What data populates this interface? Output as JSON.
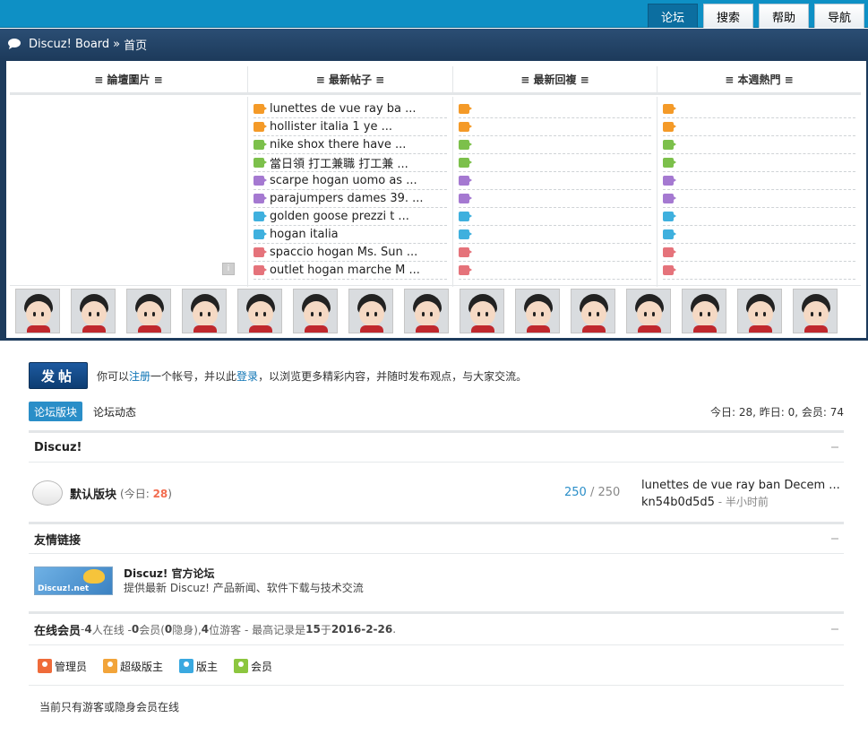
{
  "nav": {
    "items": [
      {
        "label": "论坛",
        "active": true
      },
      {
        "label": "搜索",
        "active": false
      },
      {
        "label": "帮助",
        "active": false
      },
      {
        "label": "导航",
        "active": false
      }
    ]
  },
  "breadcrumb": {
    "site": "Discuz! Board",
    "sep": "»",
    "current": "首页"
  },
  "portal": {
    "headers": [
      "≡ 論壇圖片 ≡",
      "≡ 最新帖子 ≡",
      "≡ 最新回複 ≡",
      "≡ 本週熱門 ≡"
    ],
    "latest_posts": [
      "lunettes de vue ray ba ...",
      "hollister italia 1 ye ...",
      "nike shox there have ...",
      "當日領 打工兼職 打工兼 ...",
      "scarpe hogan uomo as ...",
      "parajumpers dames 39. ...",
      "golden goose prezzi t ...",
      "hogan italia",
      "spaccio hogan Ms. Sun ...",
      "outlet hogan marche M ..."
    ],
    "rank_colors": [
      "#f49a28",
      "#f49a28",
      "#7cc04b",
      "#7cc04b",
      "#a579d1",
      "#a579d1",
      "#3fb0de",
      "#3fb0de",
      "#e5737b",
      "#e5737b"
    ],
    "ranks": [
      "1",
      "2",
      "3",
      "4",
      "5",
      "6",
      "7",
      "8",
      "9",
      "10"
    ],
    "image_thumb_label": "i"
  },
  "post": {
    "button": "发帖",
    "msg_prefix": "你可以",
    "register": "注册",
    "msg_mid": "一个帐号，并以此",
    "login": "登录",
    "msg_suffix": "，以浏览更多精彩内容，并随时发布观点，与大家交流。"
  },
  "tabs": [
    "论坛版块",
    "论坛动态"
  ],
  "stats": "今日: 28, 昨日: 0, 会员: 74",
  "category": {
    "title": "Discuz!",
    "forum": {
      "name": "默认版块",
      "today_label": "(今日: ",
      "today_value": "28",
      "today_close": ")",
      "threads": "250",
      "sep": " / ",
      "posts": "250",
      "last_title": "lunettes de vue ray ban Decem ...",
      "last_user": "kn54b0d5d5",
      "last_time": " - 半小时前"
    }
  },
  "links": {
    "title": "友情链接",
    "item": {
      "logo_text": "Discuz!.net",
      "name": "Discuz! 官方论坛",
      "desc": "提供最新 Discuz! 产品新闻、软件下载与技术交流"
    }
  },
  "online": {
    "title": "在线会员",
    "s1": " - ",
    "online_count": "4",
    "s2": " 人在线 - ",
    "member_count": "0",
    "s3": " 会员(",
    "hidden_count": "0",
    "s4": " 隐身), ",
    "guest_count": "4",
    "s5": " 位游客 - 最高记录是 ",
    "record": "15",
    "s6": " 于 ",
    "record_date": "2016-2-26",
    "s7": ".",
    "legend": [
      {
        "label": "管理员",
        "color": "#ef6b3a"
      },
      {
        "label": "超级版主",
        "color": "#f2a43a"
      },
      {
        "label": "版主",
        "color": "#3aa9e0"
      },
      {
        "label": "会员",
        "color": "#8cc63f"
      }
    ],
    "note": "当前只有游客或隐身会员在线"
  }
}
